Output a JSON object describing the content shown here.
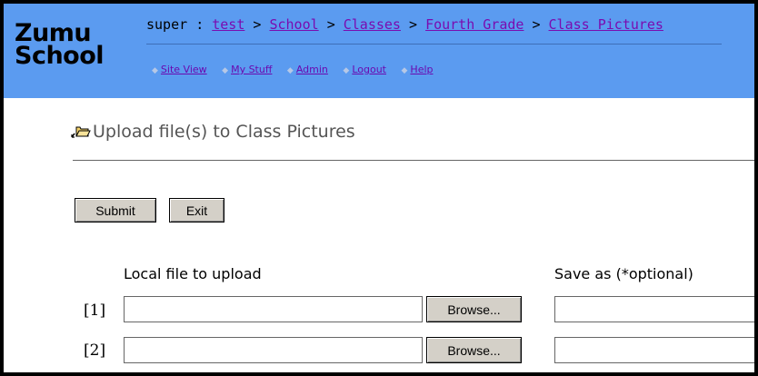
{
  "header": {
    "logo_line1": "Zumu",
    "logo_line2": "School",
    "breadcrumb": {
      "user": "super",
      "separator": ":",
      "items": [
        "test",
        "School",
        "Classes",
        "Fourth Grade",
        "Class Pictures"
      ],
      "divider": ">"
    },
    "nav": [
      {
        "label": "Site View"
      },
      {
        "label": "My Stuff"
      },
      {
        "label": "Admin"
      },
      {
        "label": "Logout"
      },
      {
        "label": "Help"
      }
    ],
    "colors": {
      "banner": "#5b9bf0",
      "link": "#7a0cb0"
    }
  },
  "page": {
    "title": "Upload file(s) to Class Pictures",
    "icon": "open-folder-icon"
  },
  "buttons": {
    "submit": "Submit",
    "exit": "Exit"
  },
  "form": {
    "local_file_label": "Local file to upload",
    "save_as_label": "Save as (*optional)",
    "rows": [
      {
        "num": "[1]",
        "file_value": "",
        "browse_label": "Browse...",
        "save_as_value": ""
      },
      {
        "num": "[2]",
        "file_value": "",
        "browse_label": "Browse...",
        "save_as_value": ""
      }
    ]
  }
}
